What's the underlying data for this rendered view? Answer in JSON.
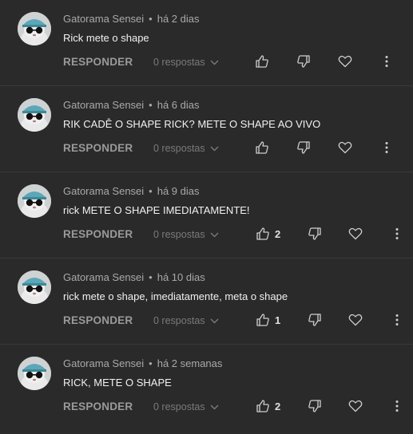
{
  "reply_label": "RESPONDER",
  "comments": [
    {
      "author": "Gatorama Sensei",
      "separator": "•",
      "time": "há 2 dias",
      "text": "Rick mete o shape",
      "replies": "0 respostas",
      "likes": ""
    },
    {
      "author": "Gatorama Sensei",
      "separator": "•",
      "time": "há 6 dias",
      "text": "RIK CADÊ O SHAPE RICK? METE O SHAPE AO VIVO",
      "replies": "0 respostas",
      "likes": ""
    },
    {
      "author": "Gatorama Sensei",
      "separator": "•",
      "time": "há 9 dias",
      "text": "rick METE O SHAPE IMEDIATAMENTE!",
      "replies": "0 respostas",
      "likes": "2"
    },
    {
      "author": "Gatorama Sensei",
      "separator": "•",
      "time": "há 10 dias",
      "text": "rick mete o shape, imediatamente, meta o shape",
      "replies": "0 respostas",
      "likes": "1"
    },
    {
      "author": "Gatorama Sensei",
      "separator": "•",
      "time": "há 2 semanas",
      "text": "RICK, METE O SHAPE",
      "replies": "0 respostas",
      "likes": "2"
    }
  ]
}
